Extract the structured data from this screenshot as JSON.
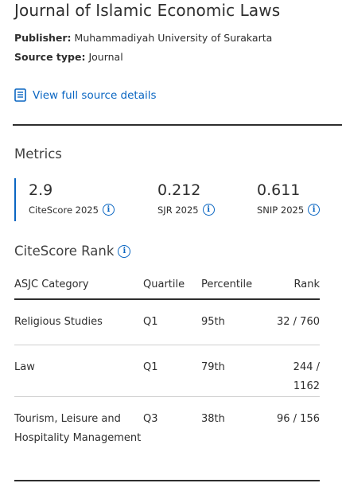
{
  "source": {
    "title": "Journal of Islamic Economic Laws",
    "publisher_label": "Publisher:",
    "publisher": "Muhammadiyah University of Surakarta",
    "source_type_label": "Source type:",
    "source_type": "Journal",
    "view_details_label": "View full source details"
  },
  "metrics": {
    "heading": "Metrics",
    "items": [
      {
        "value": "2.9",
        "label": "CiteScore 2025"
      },
      {
        "value": "0.212",
        "label": "SJR 2025"
      },
      {
        "value": "0.611",
        "label": "SNIP 2025"
      }
    ]
  },
  "rank": {
    "heading": "CiteScore Rank",
    "columns": [
      "ASJC Category",
      "Quartile",
      "Percentile",
      "Rank"
    ],
    "rows": [
      {
        "category": "Religious Studies",
        "quartile": "Q1",
        "percentile": "95th",
        "rank": "32 / 760"
      },
      {
        "category": "Law",
        "quartile": "Q1",
        "percentile": "79th",
        "rank": "244 / 1162"
      },
      {
        "category": "Tourism, Leisure and Hospitality Management",
        "quartile": "Q3",
        "percentile": "38th",
        "rank": "96 / 156"
      }
    ]
  },
  "icons": {
    "details": "document-icon",
    "info": "info-icon"
  },
  "colors": {
    "accent": "#0a66c2",
    "text": "#2e2e2e"
  }
}
